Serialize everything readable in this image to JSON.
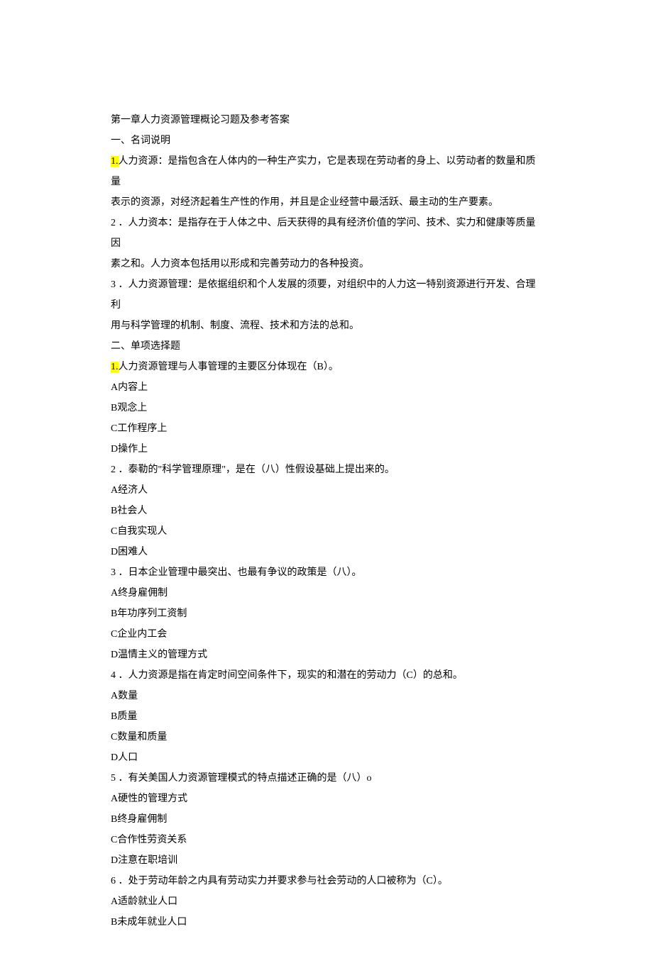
{
  "title": "第一章人力资源管理概论习题及参考答案",
  "section1_header": "一、名词说明",
  "def1_num": "1.",
  "def1_text_a": "人力资源：是指包含在人体内的一种生产实力，它是表现在劳动者的身上、以劳动者的数量和质量",
  "def1_text_b": "表示的资源，对经济起着生产性的作用，并且是企业经营中最活跃、最主动的生产要素。",
  "def2_a": "2 ．人力资本：是指存在于人体之中、后天获得的具有经济价值的学问、技术、实力和健康等质量因",
  "def2_b": "素之和。人力资本包括用以形成和完善劳动力的各种投资。",
  "def3_a": "3 ．人力资源管理：是依据组织和个人发展的须要，对组织中的人力这一特别资源进行开发、合理利",
  "def3_b": "用与科学管理的机制、制度、流程、技术和方法的总和。",
  "section2_header": "二、单项选择题",
  "q1_num": "1.",
  "q1_text": "人力资源管理与人事管理的主要区分体现在（B）。",
  "q1_a": "A内容上",
  "q1_b": "B观念上",
  "q1_c": "C工作程序上",
  "q1_d": "D操作上",
  "q2": "2 ．泰勒的\"科学管理原理\"，是在（八）性假设基础上提出来的。",
  "q2_a": "A经济人",
  "q2_b": "B社会人",
  "q2_c": "C自我实现人",
  "q2_d": "D困难人",
  "q3": "3 ．日本企业管理中最突出、也最有争议的政策是（八）。",
  "q3_a": "A终身雇佣制",
  "q3_b": "B年功序列工资制",
  "q3_c": "C企业内工会",
  "q3_d": "D温情主义的管理方式",
  "q4": "4 ．人力资源是指在肯定时间空间条件下，现实的和潜在的劳动力（C）的总和。",
  "q4_a": "A数量",
  "q4_b": "B质量",
  "q4_c": "C数量和质量",
  "q4_d": "D人口",
  "q5": "5 ．有关美国人力资源管理模式的特点描述正确的是（八）o",
  "q5_a": "A硬性的管理方式",
  "q5_b": "B终身雇佣制",
  "q5_c": "C合作性劳资关系",
  "q5_d": "D注意在职培训",
  "q6": "6 ．处于劳动年龄之内具有劳动实力并要求参与社会劳动的人口被称为（C）。",
  "q6_a": "A适龄就业人口",
  "q6_b": "B未成年就业人口"
}
